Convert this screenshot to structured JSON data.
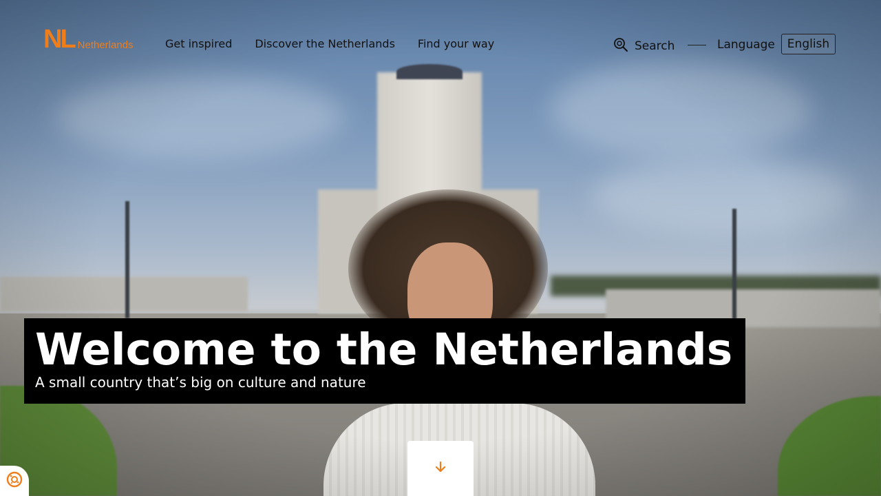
{
  "logo": {
    "mark": "NL",
    "text": "Netherlands"
  },
  "nav": {
    "items": [
      {
        "label": "Get inspired"
      },
      {
        "label": "Discover the Netherlands"
      },
      {
        "label": "Find your way"
      }
    ]
  },
  "search": {
    "label": "Search",
    "icon": "search-icon"
  },
  "language": {
    "label": "Language",
    "selected": "English"
  },
  "hero": {
    "title": "Welcome to the Netherlands",
    "subtitle": "A small country that’s big on culture and nature",
    "scroll_icon": "arrow-down-icon"
  },
  "cookie": {
    "icon": "cookie-settings-icon"
  },
  "colors": {
    "brand_orange": "#ef7d1a",
    "title_bg": "#000000",
    "title_text": "#ffffff"
  }
}
